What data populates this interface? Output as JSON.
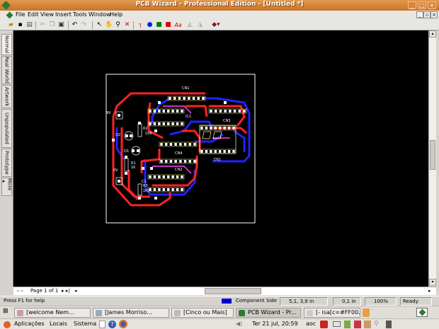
{
  "window": {
    "title": "PCB Wizard - Professional Edition - [Untitled *]"
  },
  "menu": [
    "File",
    "Edit",
    "View",
    "Insert",
    "Tools",
    "Window",
    "Help"
  ],
  "toolbar": [
    "open-icon",
    "save-icon",
    "print-icon",
    "cut-icon",
    "copy-icon",
    "paste-icon",
    "undo-icon",
    "redo-icon",
    "select-icon",
    "hand-icon",
    "zoom-icon",
    "delete-icon",
    "track-icon",
    "pad-icon",
    "square-pad-icon",
    "smd-pad-icon",
    "text-icon",
    "component-icon"
  ],
  "side_tabs": [
    "Normal",
    "Real World",
    "Artwork",
    "Unpopulated",
    "Prototype",
    "More ▸"
  ],
  "pcb": {
    "labels": {
      "cn1": "CN1",
      "ic1": "IC1",
      "cn3": "CN3",
      "ds1": "DS1",
      "cn4": "CN4",
      "cn2": "CN2",
      "r1": "R1",
      "r1v": "1K",
      "r2": "R2",
      "r2v": "10K",
      "r3": "R3",
      "r3v": "1K",
      "q1": "Q1",
      "q2": "Q2",
      "v9": "9V",
      "v0": "0V",
      "c1": "C1"
    },
    "colors": {
      "top": "#ff2020",
      "bottom": "#2020ff",
      "silk": "#ffffff",
      "board": "#ffffff"
    }
  },
  "page_nav": {
    "label": "Page 1 of 1"
  },
  "status": {
    "help": "Press F1 for help",
    "layer": "Component Side",
    "layer_color": "#0000cc",
    "coords": "5,1, 3,9 in",
    "grid": "0,1 in",
    "zoom": "100%",
    "state": "Ready"
  },
  "taskbar": [
    {
      "label": "[welcome Nem...",
      "active": false
    },
    {
      "label": "[James Morriso...",
      "active": false
    },
    {
      "label": "[Cinco ou Mais]",
      "active": false
    },
    {
      "label": "PCB Wizard - Pr...",
      "active": true
    },
    {
      "label": "[- isa[c=#FF00...",
      "active": false
    }
  ],
  "panel": {
    "apps": "Aplicações",
    "places": "Locais",
    "system": "Sistema",
    "clock": "Ter 21 jul, 20:59",
    "user": "aoc"
  }
}
